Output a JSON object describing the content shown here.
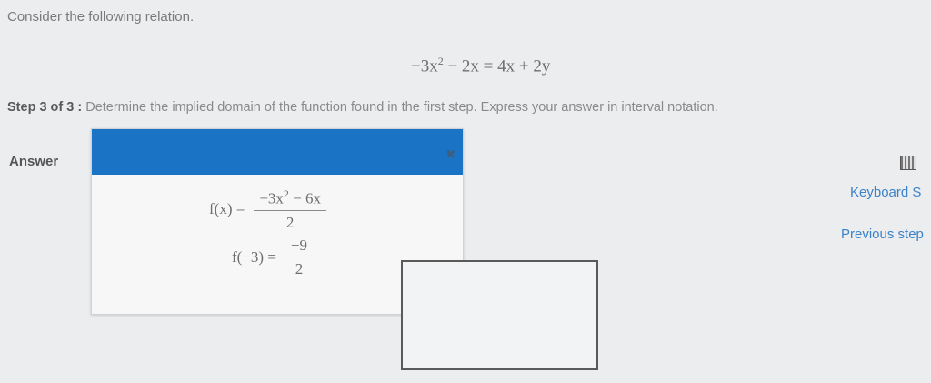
{
  "question": {
    "intro": "Consider the following relation.",
    "relation": {
      "lhs_lead": "−3x",
      "lhs_exp": "2",
      "lhs_rest": " − 2x = 4x + 2y"
    },
    "step_label": "Step 3 of 3 :",
    "step_text": " Determine the implied domain of the function found in the first step. Express your answer in interval notation."
  },
  "answer": {
    "label": "Answer",
    "close_symbol": "✖",
    "eq1": {
      "lhs": "f(x) =",
      "num_lead": "−3x",
      "num_exp": "2",
      "num_rest": " − 6x",
      "den": "2"
    },
    "eq2": {
      "lhs": "f(−3) =",
      "num": "−9",
      "den": "2"
    }
  },
  "side": {
    "keyboard_link": "Keyboard S",
    "previous_link": "Previous step"
  },
  "colors": {
    "header": "#1a73c4",
    "link": "#3b83c9"
  }
}
